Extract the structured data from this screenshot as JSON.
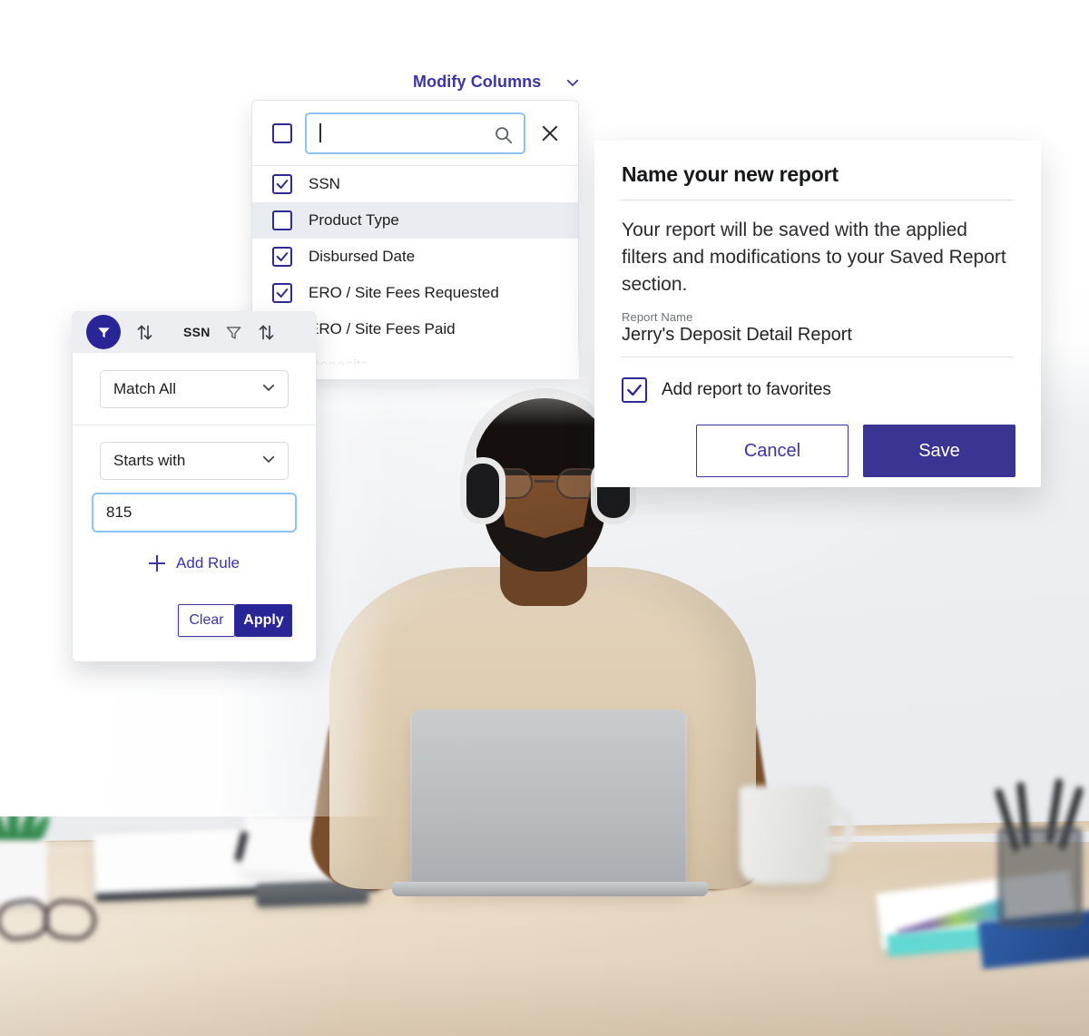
{
  "theme": {
    "brand_indigo": "#3a35a5",
    "brand_indigo_dark": "#2a2596",
    "save_button_bg": "#3a3493",
    "focus_blue": "#8cc2f5",
    "row_alt_bg": "#e9ecf1",
    "filter_header_bg": "#eceef1"
  },
  "modify_columns": {
    "label": "Modify Columns",
    "chevron_icon": "chevron-down-icon"
  },
  "columns_panel": {
    "search": {
      "value": "",
      "placeholder": "",
      "search_icon": "search-icon"
    },
    "select_all_checked": false,
    "close_icon": "close-icon",
    "items": [
      {
        "label": "SSN",
        "checked": true,
        "alt": false
      },
      {
        "label": "Product Type",
        "checked": false,
        "alt": true
      },
      {
        "label": "Disbursed Date",
        "checked": true,
        "alt": false
      },
      {
        "label": "ERO / Site Fees Requested",
        "checked": true,
        "alt": false
      },
      {
        "label": "ERO / Site Fees Paid",
        "checked": true,
        "alt": false
      },
      {
        "label": "Deposits",
        "checked": true,
        "alt": false
      }
    ]
  },
  "report_dialog": {
    "title": "Name your new report",
    "description": "Your report will be saved with the applied filters and modifications to your Saved Report section.",
    "field_label": "Report Name",
    "field_value": "Jerry's Deposit Detail Report",
    "favorite_label": "Add report to favorites",
    "favorite_checked": true,
    "cancel_label": "Cancel",
    "save_label": "Save"
  },
  "filter_popover": {
    "header": {
      "filter_badge_icon": "funnel-icon",
      "sort_icon_left": "sort-updown-icon",
      "column_tag": "SSN",
      "funnel_icon": "funnel-outline-icon",
      "sort_icon_right": "sort-updown-icon"
    },
    "match_mode": {
      "value": "Match All",
      "chevron_icon": "chevron-down-icon"
    },
    "operator": {
      "value": "Starts with",
      "chevron_icon": "chevron-down-icon"
    },
    "value_input": {
      "value": "815",
      "placeholder": ""
    },
    "add_rule_label": "Add Rule",
    "add_rule_icon": "plus-icon",
    "clear_label": "Clear",
    "apply_label": "Apply"
  },
  "photo": {
    "alt": "person-with-headphones-at-desk-using-laptop"
  }
}
